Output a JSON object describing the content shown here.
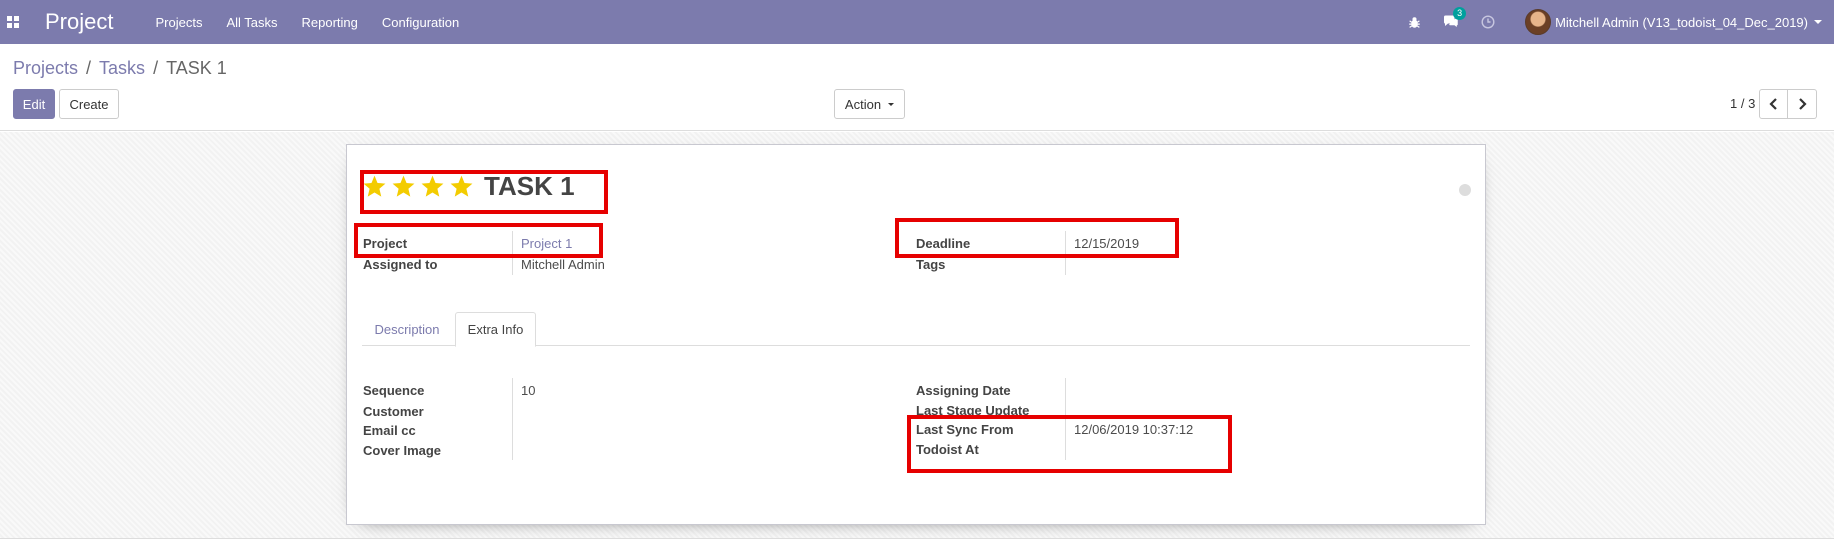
{
  "navbar": {
    "app_name": "Project",
    "menu": [
      "Projects",
      "All Tasks",
      "Reporting",
      "Configuration"
    ],
    "chat_badge": "3",
    "user_name": "Mitchell Admin (V13_todoist_04_Dec_2019)"
  },
  "breadcrumb": {
    "items": [
      "Projects",
      "Tasks"
    ],
    "separator": "/",
    "current": "TASK 1"
  },
  "toolbar": {
    "edit_label": "Edit",
    "create_label": "Create",
    "action_label": "Action",
    "pager": "1 / 3"
  },
  "colors": {
    "brand": "#7c7bad",
    "star": "#f3cc00",
    "annotation": "#e60000"
  },
  "task": {
    "priority_stars": 4,
    "name": "TASK 1"
  },
  "fields": {
    "project_label": "Project",
    "project_value": "Project 1",
    "assigned_label": "Assigned to",
    "assigned_value": "Mitchell Admin",
    "deadline_label": "Deadline",
    "deadline_value": "12/15/2019",
    "tags_label": "Tags"
  },
  "tabs": {
    "description": "Description",
    "extra_info": "Extra Info"
  },
  "extra_info": {
    "sequence_label": "Sequence",
    "sequence_value": "10",
    "customer_label": "Customer",
    "email_cc_label": "Email cc",
    "cover_image_label": "Cover Image",
    "assigning_date_label": "Assigning Date",
    "last_stage_update_label": "Last Stage Update",
    "last_sync_label_1": "Last Sync From",
    "last_sync_label_2": "Todoist At",
    "last_sync_value": "12/06/2019 10:37:12"
  },
  "icons": {
    "apps": "apps-grid-icon",
    "bug": "bug-icon",
    "chat": "chat-icon",
    "clock": "clock-icon",
    "prev": "chevron-left-icon",
    "next": "chevron-right-icon"
  }
}
